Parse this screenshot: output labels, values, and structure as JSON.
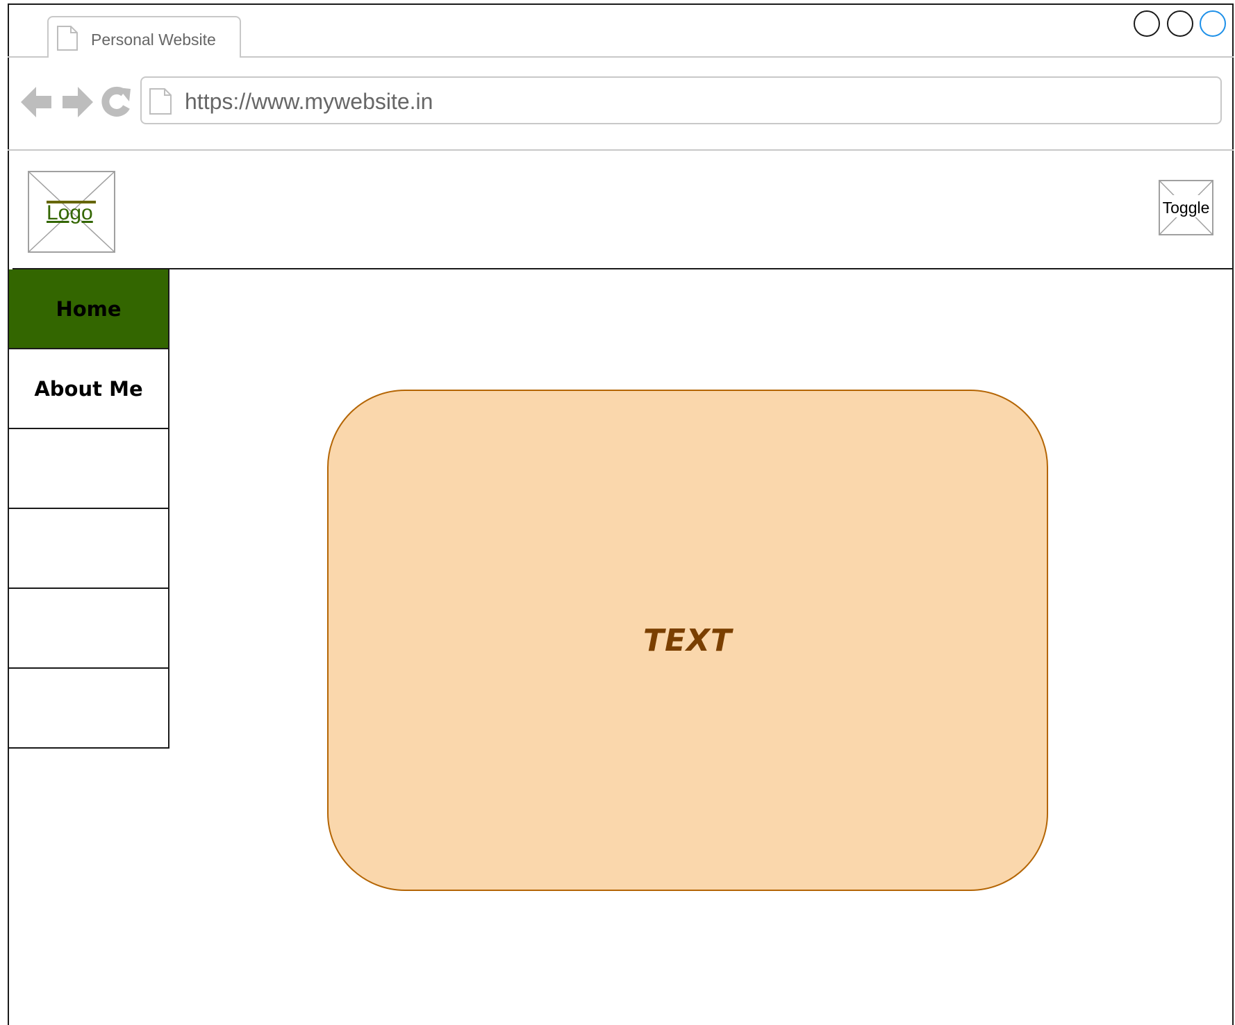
{
  "browser": {
    "tab_title": "Personal Website",
    "url": "https://www.mywebsite.in",
    "icons": {
      "tab": "page-icon",
      "address": "page-icon",
      "back": "arrow-left-icon",
      "forward": "arrow-right-icon",
      "reload": "reload-icon"
    },
    "window_buttons": [
      "minimize",
      "maximize",
      "close"
    ]
  },
  "header": {
    "logo_label": "Logo",
    "toggle_label": "Toggle"
  },
  "sidebar": {
    "items": [
      {
        "label": "Home",
        "active": true
      },
      {
        "label": "About Me",
        "active": false
      },
      {
        "label": "",
        "active": false
      },
      {
        "label": "",
        "active": false
      },
      {
        "label": "",
        "active": false
      },
      {
        "label": "",
        "active": false
      }
    ]
  },
  "main": {
    "card_text": "TEXT"
  },
  "colors": {
    "active_nav": "#336600",
    "card_fill": "#fad7ac",
    "card_stroke": "#b46504",
    "card_text": "#7a3f00",
    "close_button": "#1e90e8"
  }
}
